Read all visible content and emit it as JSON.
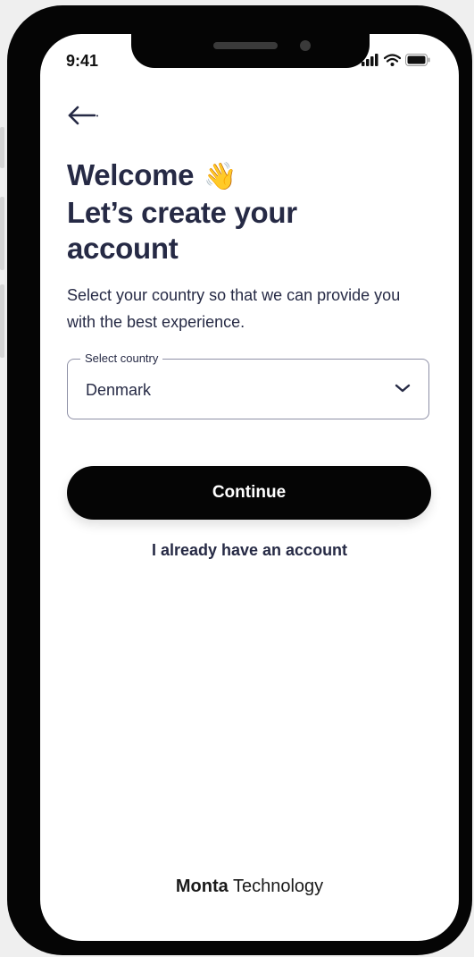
{
  "status_bar": {
    "time": "9:41"
  },
  "header": {
    "back_icon": "arrow-left-icon",
    "title_line1": "Welcome",
    "title_emoji": "👋",
    "title_line2": "Let’s create your",
    "title_line3": "account",
    "subtitle": "Select your country so that we can provide you with the best experience."
  },
  "country_select": {
    "label": "Select country",
    "value": "Denmark",
    "icon": "chevron-down-icon"
  },
  "actions": {
    "continue_label": "Continue",
    "login_label": "I already have an account"
  },
  "footer": {
    "brand_bold": "Monta",
    "brand_regular": "Technology"
  },
  "colors": {
    "text": "#262a45",
    "button": "#050505",
    "frame": "#050505",
    "background": "#ffffff"
  }
}
